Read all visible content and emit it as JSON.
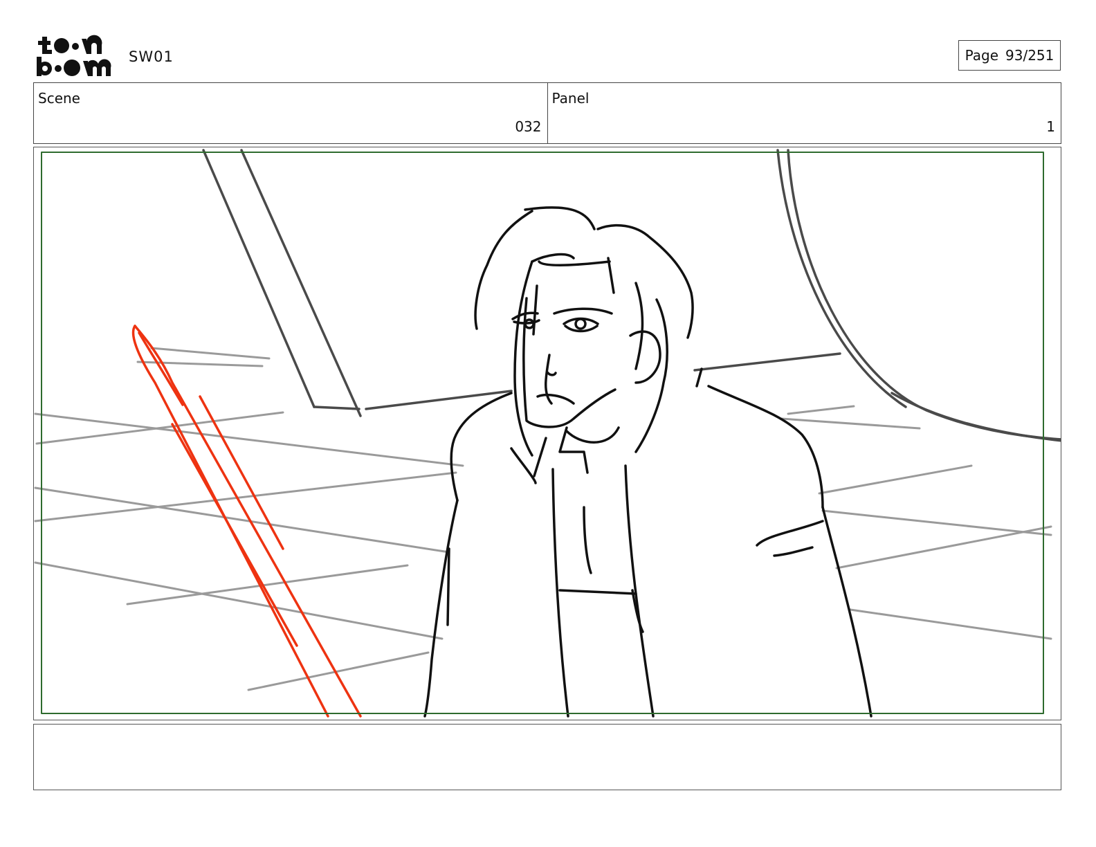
{
  "header": {
    "logo": {
      "brand": "toon boom",
      "line1": "toon",
      "line2": "boom"
    },
    "project_code": "SW01",
    "page": {
      "label": "Page",
      "value": "93/251"
    }
  },
  "info": {
    "scene": {
      "label": "Scene",
      "value": "032"
    },
    "panel": {
      "label": "Panel",
      "value": "1"
    }
  },
  "colors": {
    "frame_border": "#2e6b2e",
    "ink": "#111111",
    "pencil_gray": "#999999",
    "saber_red": "#ee3311"
  },
  "notes": ""
}
